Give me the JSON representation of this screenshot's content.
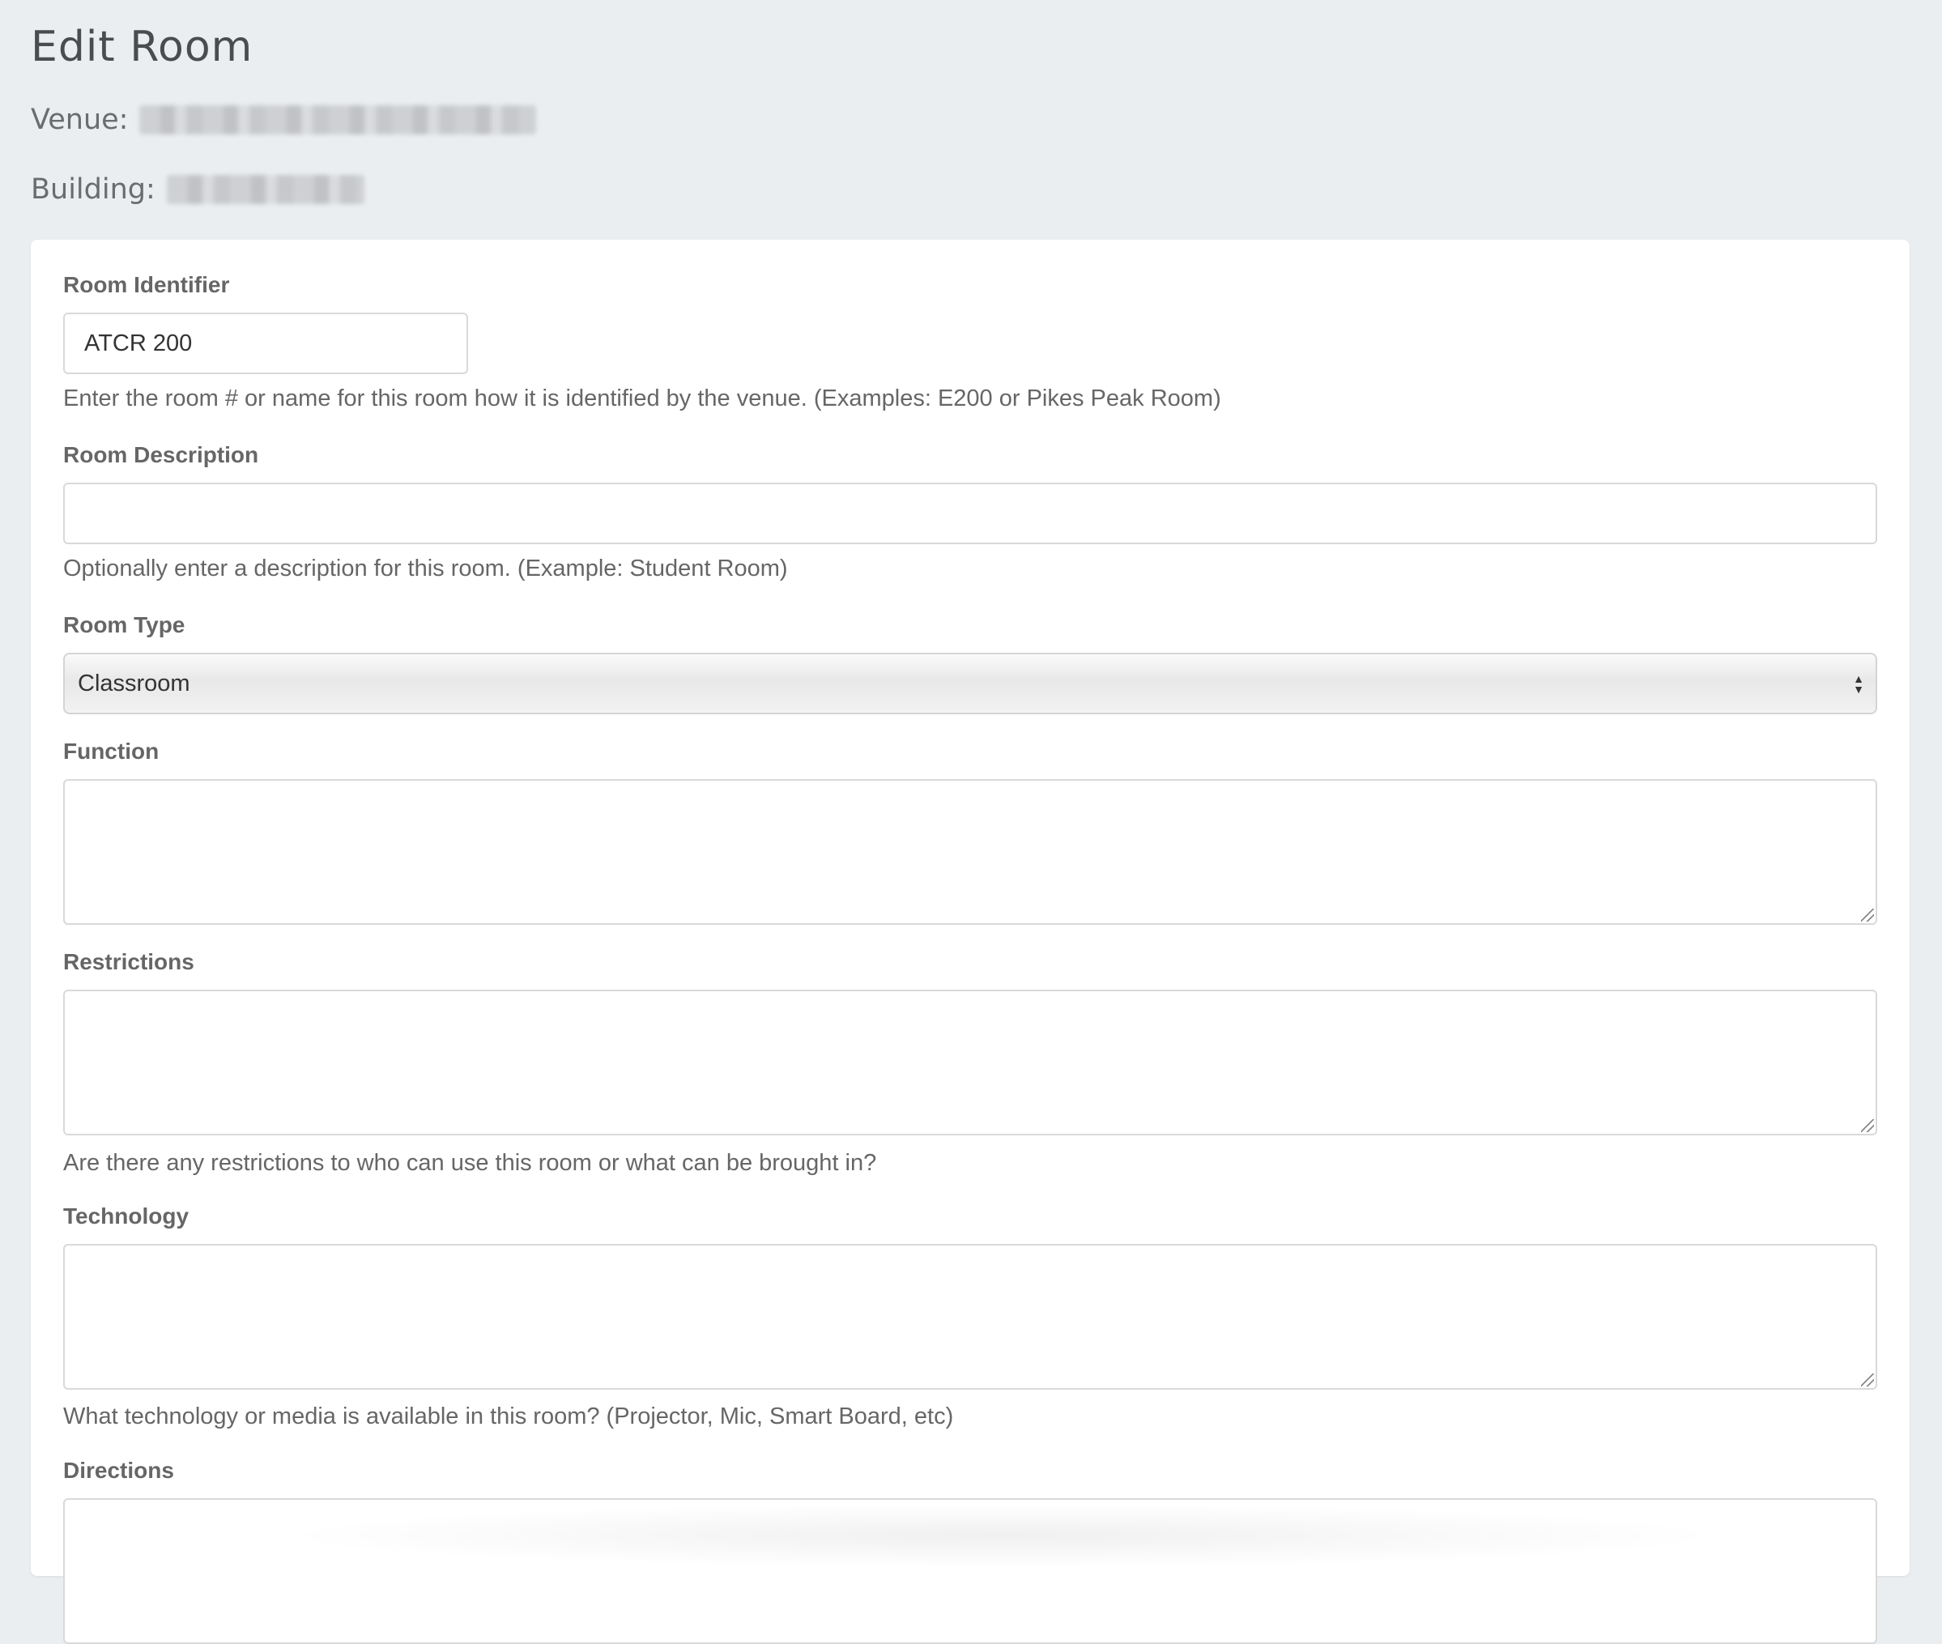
{
  "page": {
    "title": "Edit Room",
    "venue_label": "Venue:",
    "building_label": "Building:"
  },
  "form": {
    "room_identifier": {
      "label": "Room Identifier",
      "value": "ATCR 200",
      "help": "Enter the room # or name for this room how it is identified by the venue. (Examples: E200 or Pikes Peak Room)"
    },
    "room_description": {
      "label": "Room Description",
      "value": "",
      "help": "Optionally enter a description for this room. (Example: Student Room)"
    },
    "room_type": {
      "label": "Room Type",
      "selected": "Classroom"
    },
    "function": {
      "label": "Function",
      "value": ""
    },
    "restrictions": {
      "label": "Restrictions",
      "value": "",
      "help": "Are there any restrictions to who can use this room or what can be brought in?"
    },
    "technology": {
      "label": "Technology",
      "value": "",
      "help": "What technology or media is available in this room? (Projector, Mic, Smart Board, etc)"
    },
    "directions": {
      "label": "Directions",
      "value": ""
    }
  },
  "icons": {
    "select_arrows": "up-down-caret-icon",
    "resize": "resize-grip-icon"
  },
  "colors": {
    "background": "#ebeef1",
    "card": "#ffffff",
    "label": "#666666",
    "border": "#d9d9d9"
  }
}
